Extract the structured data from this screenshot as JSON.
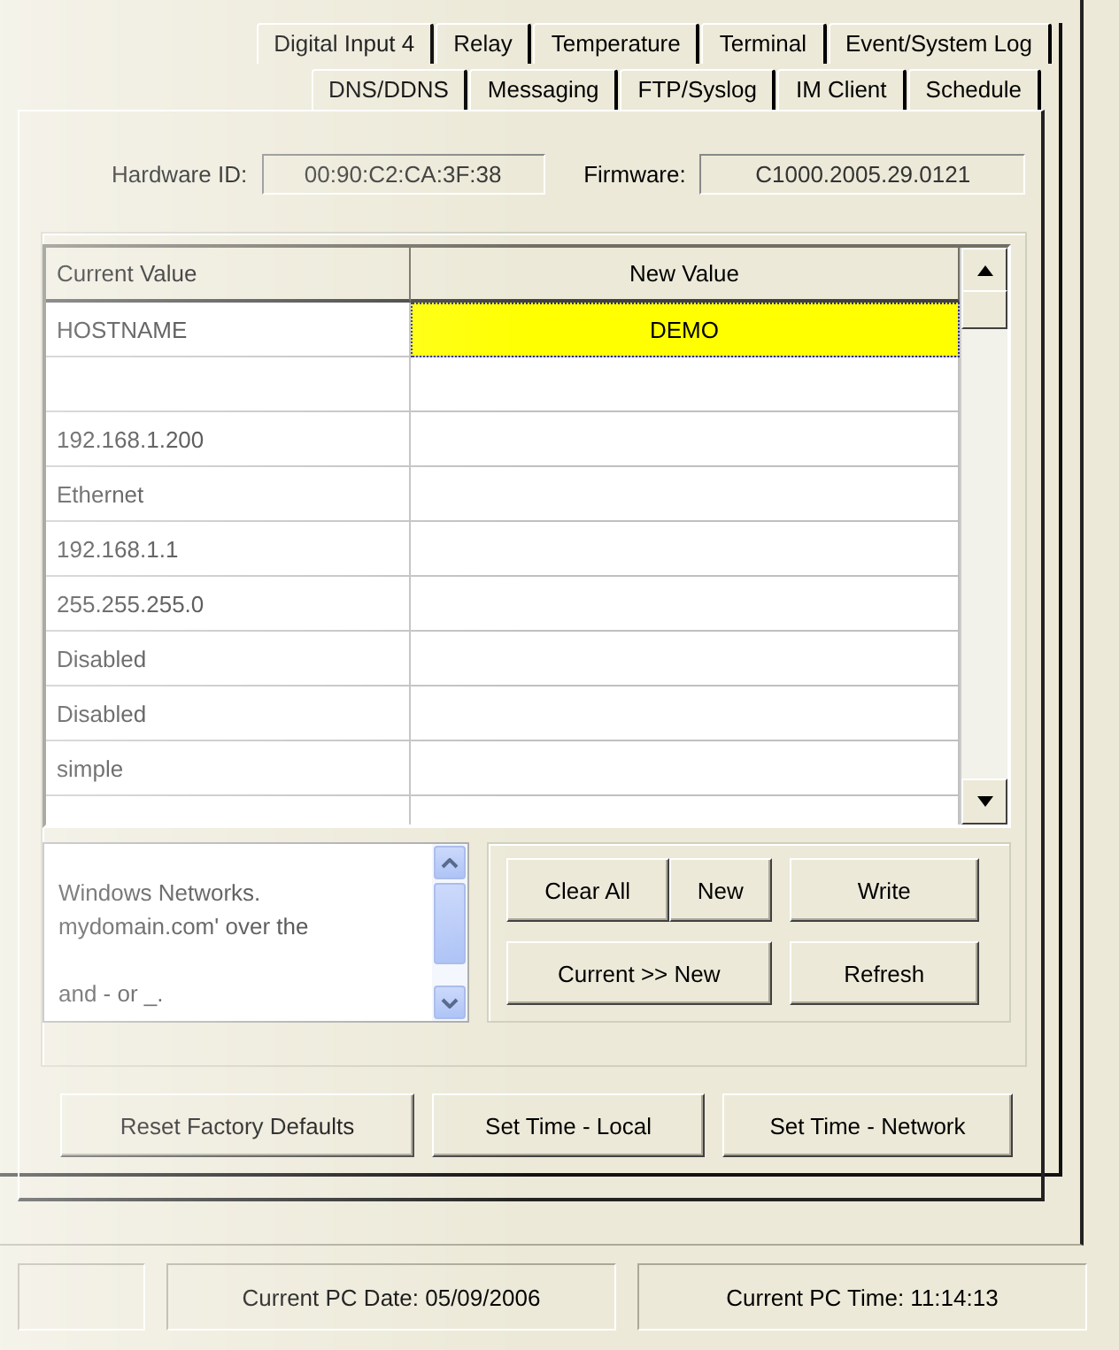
{
  "tab_rows": [
    [
      {
        "label": "Digital Input 4",
        "selected": false
      },
      {
        "label": "Relay",
        "selected": false
      },
      {
        "label": "Temperature",
        "selected": false
      },
      {
        "label": "Terminal",
        "selected": false
      },
      {
        "label": "Event/System Log",
        "selected": false
      }
    ],
    [
      {
        "label": "DNS/DDNS",
        "selected": false
      },
      {
        "label": "Messaging",
        "selected": false
      },
      {
        "label": "FTP/Syslog",
        "selected": false
      },
      {
        "label": "IM Client",
        "selected": false
      },
      {
        "label": "Schedule",
        "selected": false
      }
    ]
  ],
  "hardware_id": {
    "label": "Hardware ID:",
    "value": "00:90:C2:CA:3F:38"
  },
  "firmware": {
    "label": "Firmware:",
    "value": "C1000.2005.29.0121"
  },
  "table": {
    "columns": [
      "Current Value",
      "New Value"
    ],
    "rows": [
      {
        "current": "HOSTNAME",
        "new": "DEMO",
        "selected": true
      },
      {
        "selected": false
      },
      {
        "current": "192.168.1.200",
        "selected": false
      },
      {
        "current": "Ethernet",
        "selected": false
      },
      {
        "current": "192.168.1.1",
        "selected": false
      },
      {
        "current": "255.255.255.0",
        "selected": false
      },
      {
        "current": "Disabled",
        "selected": false
      },
      {
        "current": "Disabled",
        "selected": false
      },
      {
        "current": "simple",
        "selected": false
      }
    ]
  },
  "help_text": [
    "Windows Networks.",
    "mydomain.com' over the",
    "and - or _."
  ],
  "edit_buttons": [
    "Clear All",
    "New",
    "Write",
    "Current >> New",
    "Refresh"
  ],
  "action_buttons": [
    "Reset Factory Defaults",
    "Set Time - Local",
    "Set Time - Network"
  ],
  "status_bar": [
    "Current PC Date: 05/09/2006",
    "Current PC Time: 11:14:13"
  ]
}
